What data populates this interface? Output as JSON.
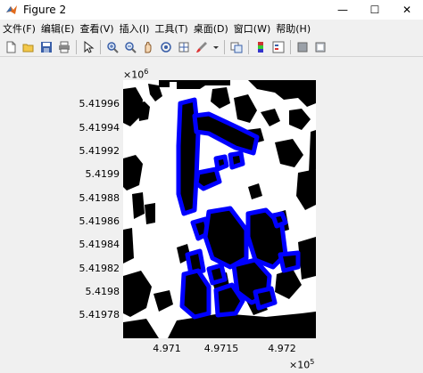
{
  "window": {
    "title": "Figure 2",
    "controls": {
      "minimize": "—",
      "maximize": "☐",
      "close": "✕"
    }
  },
  "menubar": {
    "items": [
      {
        "label": "文件(F)"
      },
      {
        "label": "编辑(E)"
      },
      {
        "label": "查看(V)"
      },
      {
        "label": "插入(I)"
      },
      {
        "label": "工具(T)"
      },
      {
        "label": "桌面(D)"
      },
      {
        "label": "窗口(W)"
      },
      {
        "label": "帮助(H)"
      }
    ]
  },
  "toolbar": {
    "icons": [
      "new-figure-icon",
      "open-file-icon",
      "save-icon",
      "print-icon",
      "edit-plot-icon",
      "zoom-in-icon",
      "zoom-out-icon",
      "pan-icon",
      "rotate-3d-icon",
      "data-cursor-icon",
      "brush-icon",
      "dropdown-arrow-icon",
      "link-plot-icon",
      "insert-colorbar-icon",
      "insert-legend-icon",
      "hide-plot-tools-icon",
      "show-plot-tools-icon"
    ]
  },
  "axes": {
    "y_exponent_base": "×10",
    "y_exponent_power": "6",
    "x_exponent_base": "×10",
    "x_exponent_power": "5",
    "y_ticks": [
      "5.41996",
      "5.41994",
      "5.41992",
      "5.4199",
      "5.41988",
      "5.41986",
      "5.41984",
      "5.41982",
      "5.4198",
      "5.41978"
    ],
    "x_ticks": [
      "4.971",
      "4.9715",
      "4.972"
    ]
  },
  "colors": {
    "plot_background": "#ffffff",
    "building_fill": "#000000",
    "highlight": "#0000ff"
  }
}
